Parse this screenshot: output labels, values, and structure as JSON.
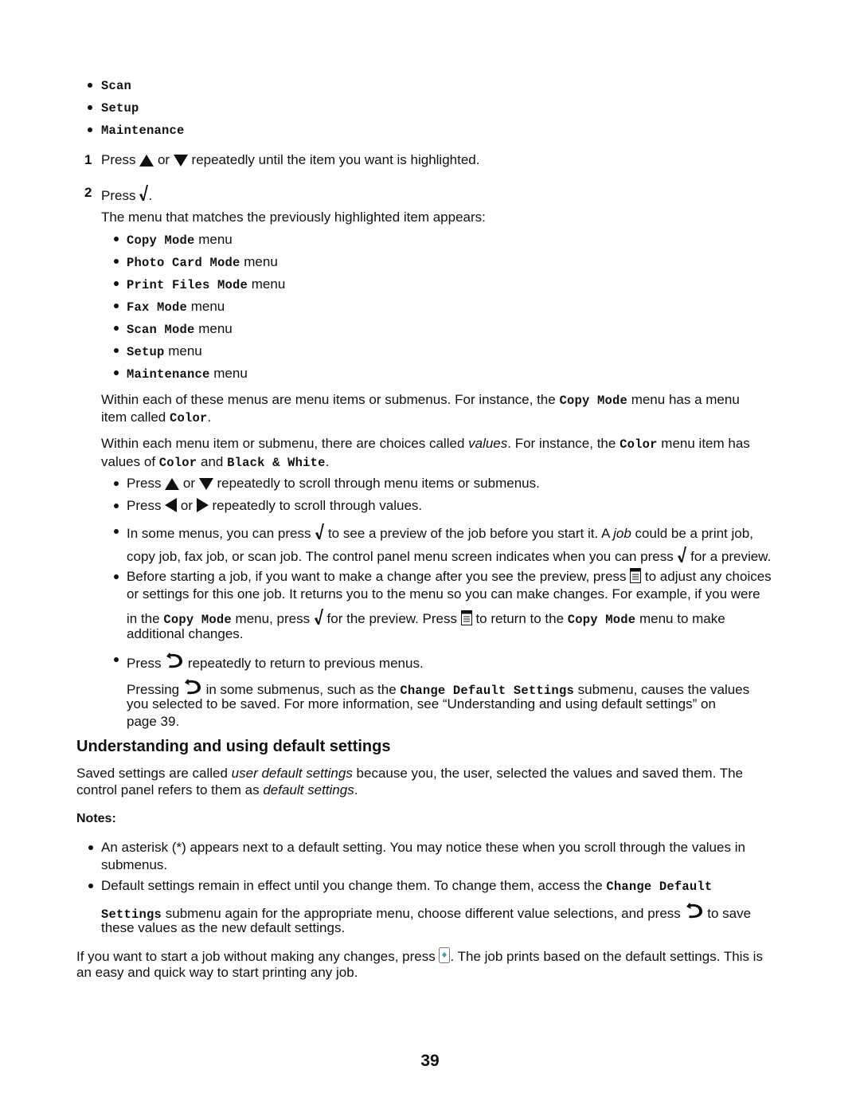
{
  "top_list": [
    "Scan",
    "Setup",
    "Maintenance"
  ],
  "steps": {
    "step1": {
      "num": "1",
      "a": "Press",
      "b": "or",
      "c": "repeatedly until the item you want is highlighted."
    },
    "step2": {
      "num": "2",
      "a": "Press",
      "b": "."
    }
  },
  "menu_intro": "The menu that matches the previously highlighted item appears:",
  "menus": [
    {
      "name": "Copy Mode",
      "suffix": " menu"
    },
    {
      "name": "Photo Card Mode",
      "suffix": " menu"
    },
    {
      "name": "Print Files Mode",
      "suffix": " menu"
    },
    {
      "name": "Fax Mode",
      "suffix": " menu"
    },
    {
      "name": "Scan Mode",
      "suffix": " menu"
    },
    {
      "name": "Setup",
      "suffix": " menu"
    },
    {
      "name": "Maintenance",
      "suffix": " menu"
    }
  ],
  "para1": {
    "l1a": "Within each of these menus are menu items or submenus. For instance, the ",
    "l1code": "Copy Mode",
    "l1b": " menu has a menu",
    "l2a": "item called ",
    "l2code": "Color",
    "l2b": "."
  },
  "para2": {
    "l1a": "Within each menu item or submenu, there are choices called ",
    "l1em": "values",
    "l1b": ". For instance, the ",
    "l1code": "Color",
    "l1c": " menu item has",
    "l2a": "values of ",
    "l2code1": "Color",
    "l2b": " and ",
    "l2code2": "Black & White",
    "l2c": "."
  },
  "tips": {
    "t1": {
      "a": "Press ",
      "b": " or ",
      "c": " repeatedly to scroll through menu items or submenus."
    },
    "t2": {
      "a": "Press ",
      "b": " or ",
      "c": " repeatedly to scroll through values."
    },
    "t3": {
      "l1a": "In some menus, you can press ",
      "l1b": " to see a preview of the job before you start it. A ",
      "l1em": "job",
      "l1c": " could be a print job,",
      "l2a": "copy job, fax job, or scan job. The control panel menu screen indicates when you can press ",
      "l2b": " for a preview."
    },
    "t4": {
      "l1a": "Before starting a job, if you want to make a change after you see the preview, press ",
      "l1b": " to adjust any choices",
      "l2": "or settings for this one job. It returns you to the menu so you can make changes. For example, if you were",
      "l3a": "in the ",
      "l3code1": "Copy Mode",
      "l3b": " menu, press ",
      "l3c": " for the preview. Press ",
      "l3d": " to return to the ",
      "l3code2": "Copy Mode",
      "l3e": " menu to make",
      "l4": "additional changes."
    },
    "t5": {
      "a": "Press ",
      "b": " repeatedly to return to previous menus."
    },
    "t5b": {
      "l1a": "Pressing ",
      "l1b": " in some submenus, such as the ",
      "l1code": "Change Default Settings",
      "l1c": " submenu, causes the values",
      "l2": "you selected to be saved. For more information, see “Understanding and using default settings” on",
      "l3": "page 39."
    }
  },
  "section": {
    "heading": "Understanding and using default settings",
    "intro": {
      "l1a": "Saved settings are called ",
      "l1em": "user default settings",
      "l1b": " because you, the user, selected the values and saved them. The",
      "l2a": "control panel refers to them as ",
      "l2em": "default settings",
      "l2b": "."
    },
    "notes_label": "Notes:",
    "note1": {
      "l1": "An asterisk (*) appears next to a default setting. You may notice these when you scroll through the values in",
      "l2": "submenus."
    },
    "note2": {
      "l1a": "Default settings remain in effect until you change them. To change them, access the ",
      "l1code": "Change Default",
      "l2code": "Settings",
      "l2a": " submenu again for the appropriate menu, choose different value selections, and press ",
      "l2b": " to save",
      "l3": "these values as the new default settings."
    },
    "outro": {
      "l1a": "If you want to start a job without making any changes, press ",
      "l1b": ". The job prints based on the default settings. This is",
      "l2": "an easy and quick way to start printing any job."
    }
  },
  "page_number": "39",
  "icons": {
    "up": "up-arrow-button",
    "down": "down-arrow-button",
    "left": "left-arrow-button",
    "right": "right-arrow-button",
    "select": "checkmark-button",
    "options": "options-menu-button",
    "back": "back-arrow-button",
    "start": "start-button"
  },
  "colors": {
    "text": "#111111",
    "start_icon": "#3aa6a0"
  }
}
